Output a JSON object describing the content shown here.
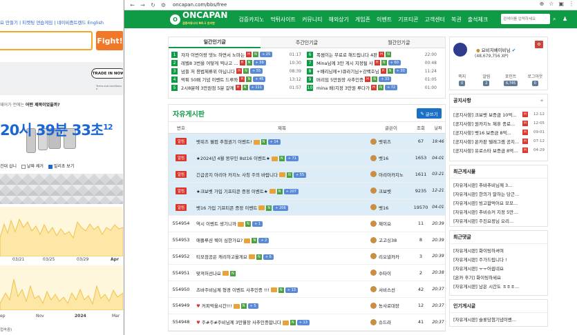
{
  "bg": {
    "links": "요 만들기 | 티켓팅 연습게임 | 네이비즘트렌드  English",
    "fight": "Fight!",
    "trade": "TRADE IN NOW",
    "terms": "Terms and conditions a",
    "question_pre": "재어가 전에는 ",
    "question_em": "어떤 제목이었을까?",
    "time": "20시 39분 33초",
    "time_suffix": "12",
    "opt1": "건대 삽니",
    "opt2": "날짜 제거",
    "opt3": "밀리초 보기",
    "ticks1": [
      "03/21",
      "03/25",
      "03/29",
      "Apr"
    ],
    "ticks2": [
      "ep",
      "Nov",
      "2024",
      "Mar"
    ],
    "footer": "접속중)"
  },
  "browser": {
    "url": "oncapan.com/bbs/free"
  },
  "nav": {
    "logo": "ONCAPAN",
    "logo_sub": "검증커뮤니티 NO.1 온카판",
    "logo_mark": "O",
    "menu": [
      "검증카지노",
      "먹튀사이트",
      "커뮤니티",
      "해외상기",
      "게임존",
      "이벤트",
      "기프티콘",
      "고객센터",
      "복권",
      "출석체크"
    ],
    "search_placeholder": "검색어를 입력하세요"
  },
  "popular": {
    "tabs": [
      "일간인기글",
      "주간인기글",
      "월간인기글"
    ],
    "left": [
      {
        "rank": "1",
        "title": "자자 이번이랑 댓노 하면서 노마는",
        "cnt": "+ 25",
        "date": "01:17"
      },
      {
        "rank": "2",
        "title": "레벨8 3번을 어떻게 찍나고 ...",
        "cnt": "+ 59",
        "date": "10:30"
      },
      {
        "rank": "3",
        "title": "넘들 저 용법제류위 아닙니다",
        "cnt": "+ 55",
        "date": "08:39"
      },
      {
        "rank": "4",
        "title": "먹튀 50배 기념 이벤트 드루와",
        "cnt": "+ 45",
        "date": "13:12"
      },
      {
        "rank": "5",
        "title": "2시8분에 3만원점 5분 갈께",
        "cnt": "+ 111",
        "date": "01:57"
      }
    ],
    "right": [
      {
        "rank": "6",
        "title": "폭썸이는 무료로 해드립니다 4판",
        "cnt": "",
        "date": "22:00"
      },
      {
        "rank": "7",
        "title": "Mina님께 3만 게시 지정될 사",
        "cnt": "+ 60",
        "date": "00:48"
      },
      {
        "rank": "8",
        "title": "+배리님께+)큐라기님+강백호님",
        "cnt": "+ 30",
        "date": "11:24"
      },
      {
        "rank": "9",
        "title": "버리임 5만원장 사추인증",
        "cnt": "+ 33",
        "date": "01:05"
      },
      {
        "rank": "10",
        "title": "mina 배)지정 3만원 루다가",
        "cnt": "+ 72",
        "date": "01:00"
      }
    ]
  },
  "free": {
    "title": "자유게시판",
    "write": "글쓰기",
    "headers": [
      "번호",
      "제목",
      "글쓴이",
      "조회",
      "날짜"
    ],
    "rows": [
      {
        "no": "알림",
        "title": "벳위즈 웰컴 추첨권기 이벤트!",
        "cnt": "+ 14",
        "author": "벳위즈",
        "views": "67",
        "date": "19:46",
        "notice": true
      },
      {
        "no": "알림",
        "title": "★2024년 4월 몽무인 8st16 이벤트★",
        "cnt": "+ 71",
        "author": "벳16",
        "views": "1653",
        "date": "04-01",
        "notice": true
      },
      {
        "no": "알림",
        "title": "긴급공지 아리아 카지노 사칭 주의 바랍니다",
        "cnt": "+ 55",
        "author": "아리아카지노",
        "views": "1611",
        "date": "03-21",
        "notice": true
      },
      {
        "no": "알림",
        "title": "★크보벳 가입 기프티콘 증정 이벤트★",
        "cnt": "+ 207",
        "author": "크보벳",
        "views": "9235",
        "date": "12-21",
        "notice": true
      },
      {
        "no": "알림",
        "title": "벳16 가입 기프티콘 증정 이벤트",
        "cnt": "+ 206",
        "author": "벳16",
        "views": "19570",
        "date": "04-01",
        "notice": true
      },
      {
        "no": "554954",
        "title": "역시 이벤트 생기니까",
        "cnt": "+ 1",
        "author": "제이요",
        "views": "11",
        "date": "20:39",
        "notice": false
      },
      {
        "no": "554953",
        "title": "애플루션 웩이 심한가요?",
        "cnt": "+ 2",
        "author": "고고싱38",
        "views": "8",
        "date": "20:39",
        "notice": false
      },
      {
        "no": "554952",
        "title": "티모점공은 캐리하고올게요",
        "cnt": "+ 6",
        "author": "리오넬카카",
        "views": "3",
        "date": "20:39",
        "notice": false
      },
      {
        "no": "554951",
        "title": "맞져허선나요",
        "cnt": "",
        "author": "수타이",
        "views": "2",
        "date": "20:38",
        "notice": false
      },
      {
        "no": "554950",
        "title": "츠바주비님께 형경 이벤트 사추인증 !!!",
        "cnt": "+ 13",
        "author": "서비스선",
        "views": "42",
        "date": "20:37",
        "notice": false
      },
      {
        "no": "554949",
        "title": "커피먹을시간!!!",
        "cnt": "+ 5",
        "author": "농사로대장",
        "views": "12",
        "date": "20:37",
        "notice": false
      },
      {
        "no": "554948",
        "title": "주#주#주비님께 3만월장 사추인증합니다",
        "cnt": "+ 13",
        "author": "슈드라",
        "views": "41",
        "date": "20:37",
        "notice": false
      },
      {
        "no": "554947",
        "title": "벳16 다 뒤졌다 ㅎㅎ",
        "cnt": "+ 9",
        "author": "가즈아보자",
        "views": "27",
        "date": "20:36",
        "notice": false
      }
    ]
  },
  "profile": {
    "name": "요비치베이비님",
    "xp": "(48,679,756 XP)",
    "stats": [
      {
        "label": "쪽지",
        "value": "0"
      },
      {
        "label": "알림",
        "value": "2"
      },
      {
        "label": "포인트",
        "value": "6,745"
      },
      {
        "label": "로그아웃",
        "value": "0"
      }
    ]
  },
  "notice_box": {
    "title": "공지사항",
    "plus": "+",
    "items": [
      {
        "text": "[공지사항] 크보벳 보증금 10억...",
        "date": "12-12"
      },
      {
        "text": "[공지사항] 원카지노 제휴 종료...",
        "date": "12-05"
      },
      {
        "text": "[공지사항] 벳16 보증금 8억...",
        "date": "09-01"
      },
      {
        "text": "[공지사항] 온카판 텔레그램 공지...",
        "date": "07-12"
      },
      {
        "text": "[공지사항] 유로스타 보증금 8억...",
        "date": "04-29"
      }
    ]
  },
  "recent_posts": {
    "title": "최근게시물",
    "items": [
      {
        "text": "[자유게시판] 추바추비님께 3..."
      },
      {
        "text": "[자유게시판] 한의가 말하는 당근..."
      },
      {
        "text": "[자유게시판] 빙고합먹어요 모모..."
      },
      {
        "text": "[자유게시판] 추비슈커 지정 5만..."
      },
      {
        "text": "[자유게시판] 주진요정님 오리..."
      }
    ]
  },
  "recent_comments": {
    "title": "최근댓글",
    "items": [
      {
        "text": "[자유게시판] 화이팅하셔여"
      },
      {
        "text": "[자유게시판] 주가드립니다 !"
      },
      {
        "text": "[자유게시판] ㅜㅜ어쉽네요"
      },
      {
        "text": "[온카 후기] 화이팅하세요"
      },
      {
        "text": "[자유게시판] 남은 시간도 ㅎㅎㅎ..."
      }
    ]
  },
  "popular_box": {
    "title": "인기게시글",
    "items": [
      {
        "text": "[자유게시판] 슬롯당첨기념이벤..."
      }
    ]
  }
}
